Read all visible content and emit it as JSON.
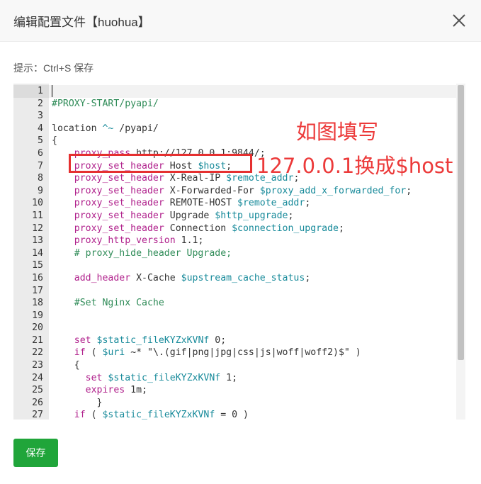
{
  "dialog": {
    "title": "编辑配置文件【huohua】",
    "hint": "提示：Ctrl+S 保存",
    "save_label": "保存"
  },
  "annotations": {
    "note1": "如图填写",
    "note2": "127.0.0.1换成$host"
  },
  "editor": {
    "lines": [
      {
        "n": "1",
        "tokens": []
      },
      {
        "n": "2",
        "tokens": [
          {
            "t": "#PROXY-START/pyapi/",
            "c": "comment"
          }
        ]
      },
      {
        "n": "3",
        "tokens": []
      },
      {
        "n": "4",
        "tokens": [
          {
            "t": "location ",
            "c": ""
          },
          {
            "t": "^~",
            "c": "var"
          },
          {
            "t": " /pyapi/",
            "c": ""
          }
        ]
      },
      {
        "n": "5",
        "tokens": [
          {
            "t": "{",
            "c": ""
          }
        ]
      },
      {
        "n": "6",
        "tokens": [
          {
            "t": "    ",
            "c": ""
          },
          {
            "t": "proxy_pass",
            "c": "kw"
          },
          {
            "t": " http://127.0.0.1:9844/;",
            "c": ""
          }
        ]
      },
      {
        "n": "7",
        "tokens": [
          {
            "t": "    ",
            "c": ""
          },
          {
            "t": "proxy_set_header",
            "c": "kw"
          },
          {
            "t": " Host ",
            "c": ""
          },
          {
            "t": "$host",
            "c": "var"
          },
          {
            "t": ";",
            "c": ""
          }
        ]
      },
      {
        "n": "8",
        "tokens": [
          {
            "t": "    ",
            "c": ""
          },
          {
            "t": "proxy_set_header",
            "c": "kw"
          },
          {
            "t": " X-Real-IP ",
            "c": ""
          },
          {
            "t": "$remote_addr",
            "c": "var"
          },
          {
            "t": ";",
            "c": ""
          }
        ]
      },
      {
        "n": "9",
        "tokens": [
          {
            "t": "    ",
            "c": ""
          },
          {
            "t": "proxy_set_header",
            "c": "kw"
          },
          {
            "t": " X-Forwarded-For ",
            "c": ""
          },
          {
            "t": "$proxy_add_x_forwarded_for",
            "c": "var"
          },
          {
            "t": ";",
            "c": ""
          }
        ]
      },
      {
        "n": "10",
        "tokens": [
          {
            "t": "    ",
            "c": ""
          },
          {
            "t": "proxy_set_header",
            "c": "kw"
          },
          {
            "t": " REMOTE-HOST ",
            "c": ""
          },
          {
            "t": "$remote_addr",
            "c": "var"
          },
          {
            "t": ";",
            "c": ""
          }
        ]
      },
      {
        "n": "11",
        "tokens": [
          {
            "t": "    ",
            "c": ""
          },
          {
            "t": "proxy_set_header",
            "c": "kw"
          },
          {
            "t": " Upgrade ",
            "c": ""
          },
          {
            "t": "$http_upgrade",
            "c": "var"
          },
          {
            "t": ";",
            "c": ""
          }
        ]
      },
      {
        "n": "12",
        "tokens": [
          {
            "t": "    ",
            "c": ""
          },
          {
            "t": "proxy_set_header",
            "c": "kw"
          },
          {
            "t": " Connection ",
            "c": ""
          },
          {
            "t": "$connection_upgrade",
            "c": "var"
          },
          {
            "t": ";",
            "c": ""
          }
        ]
      },
      {
        "n": "13",
        "tokens": [
          {
            "t": "    ",
            "c": ""
          },
          {
            "t": "proxy_http_version",
            "c": "kw"
          },
          {
            "t": " 1.1;",
            "c": ""
          }
        ]
      },
      {
        "n": "14",
        "tokens": [
          {
            "t": "    ",
            "c": ""
          },
          {
            "t": "# proxy_hide_header Upgrade;",
            "c": "comment"
          }
        ]
      },
      {
        "n": "15",
        "tokens": []
      },
      {
        "n": "16",
        "tokens": [
          {
            "t": "    ",
            "c": ""
          },
          {
            "t": "add_header",
            "c": "kw"
          },
          {
            "t": " X-Cache ",
            "c": ""
          },
          {
            "t": "$upstream_cache_status",
            "c": "var"
          },
          {
            "t": ";",
            "c": ""
          }
        ]
      },
      {
        "n": "17",
        "tokens": []
      },
      {
        "n": "18",
        "tokens": [
          {
            "t": "    ",
            "c": ""
          },
          {
            "t": "#Set Nginx Cache",
            "c": "comment"
          }
        ]
      },
      {
        "n": "19",
        "tokens": []
      },
      {
        "n": "20",
        "tokens": []
      },
      {
        "n": "21",
        "tokens": [
          {
            "t": "    ",
            "c": ""
          },
          {
            "t": "set",
            "c": "kw"
          },
          {
            "t": " ",
            "c": ""
          },
          {
            "t": "$static_fileKYZxKVNf",
            "c": "var"
          },
          {
            "t": " 0;",
            "c": ""
          }
        ]
      },
      {
        "n": "22",
        "tokens": [
          {
            "t": "    ",
            "c": ""
          },
          {
            "t": "if",
            "c": "kw"
          },
          {
            "t": " ( ",
            "c": ""
          },
          {
            "t": "$uri",
            "c": "var"
          },
          {
            "t": " ~* \"\\.(gif|png|jpg|css|js|woff|woff2)$\" )",
            "c": ""
          }
        ]
      },
      {
        "n": "23",
        "tokens": [
          {
            "t": "    {",
            "c": ""
          }
        ]
      },
      {
        "n": "24",
        "tokens": [
          {
            "t": "      ",
            "c": ""
          },
          {
            "t": "set",
            "c": "kw"
          },
          {
            "t": " ",
            "c": ""
          },
          {
            "t": "$static_fileKYZxKVNf",
            "c": "var"
          },
          {
            "t": " 1;",
            "c": ""
          }
        ]
      },
      {
        "n": "25",
        "tokens": [
          {
            "t": "      ",
            "c": ""
          },
          {
            "t": "expires",
            "c": "kw"
          },
          {
            "t": " 1m;",
            "c": ""
          }
        ]
      },
      {
        "n": "26",
        "tokens": [
          {
            "t": "        }",
            "c": ""
          }
        ]
      },
      {
        "n": "27",
        "tokens": [
          {
            "t": "    ",
            "c": ""
          },
          {
            "t": "if",
            "c": "kw"
          },
          {
            "t": " ( ",
            "c": ""
          },
          {
            "t": "$static_fileKYZxKVNf",
            "c": "var"
          },
          {
            "t": " = 0 )",
            "c": ""
          }
        ]
      }
    ]
  }
}
